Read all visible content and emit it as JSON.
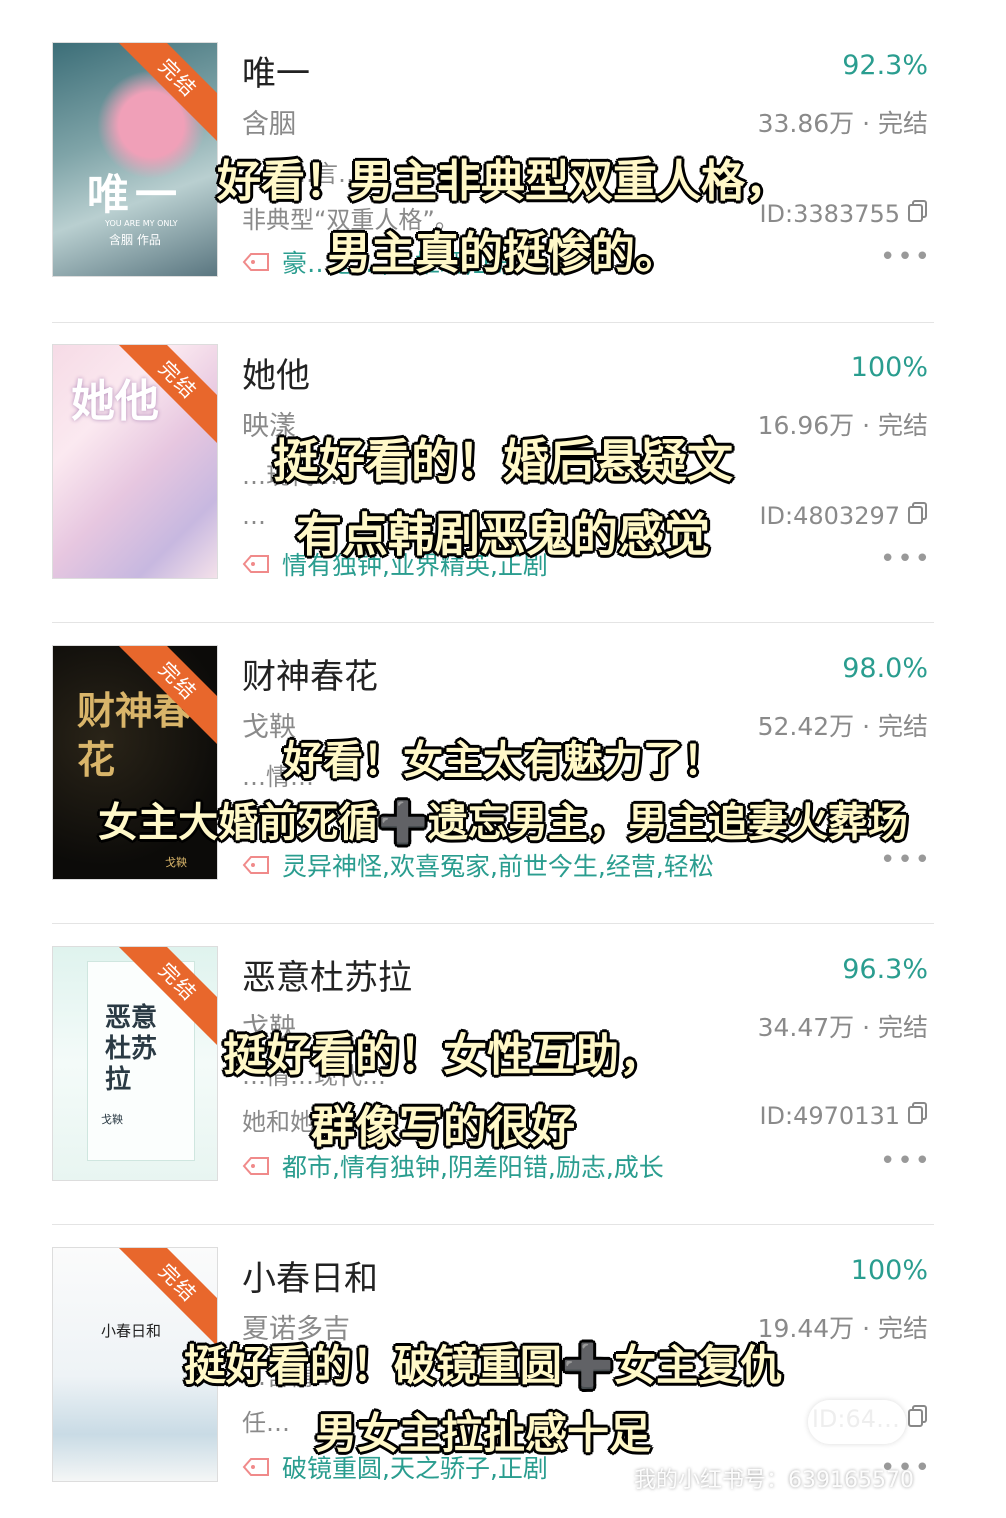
{
  "books": [
    {
      "title": "唯一",
      "author": "含胭",
      "line3": "…剧…言…",
      "line4": "非典型“双重人格”。",
      "tags": "豪…恋…,…推理,正剧",
      "percent": "92.3%",
      "meta": "33.86万 · 完结",
      "id": "ID:3383755",
      "ribbon": "完结",
      "cover_title": "唯一",
      "cover_sub": "YOU ARE MY ONLY",
      "cover_author": "含胭 作品",
      "overlay": [
        "好看！男主非典型双重人格，",
        "男主真的挺惨的。"
      ]
    },
    {
      "title": "她他",
      "author": "映漾",
      "line3": "…现代…",
      "line4": "…",
      "tags": "情有独钟,业界精英,正剧",
      "percent": "100%",
      "meta": "16.96万 · 完结",
      "id": "ID:4803297",
      "ribbon": "完结",
      "cover_title": "她他",
      "overlay": [
        "挺好看的！婚后悬疑文",
        "有点韩剧恶鬼的感觉"
      ]
    },
    {
      "title": "财神春花",
      "author": "戈鞅",
      "line3": "…情…",
      "line4": "…助…",
      "tags": "灵异神怪,欢喜冤家,前世今生,经营,轻松",
      "percent": "98.0%",
      "meta": "52.42万 · 完结",
      "id": "",
      "ribbon": "完结",
      "cover_title": "财神春花",
      "cover_author": "戈鞅",
      "overlay": [
        "好看！女主太有魅力了！",
        "女主大婚前死循➕遗忘男主，男主追妻火葬场"
      ]
    },
    {
      "title": "恶意杜苏拉",
      "author": "戈鞅",
      "line3": "…情…现代…",
      "line4": "她和她…",
      "tags": "都市,情有独钟,阴差阳错,励志,成长",
      "percent": "96.3%",
      "meta": "34.47万 · 完结",
      "id": "ID:4970131",
      "ribbon": "完结",
      "cover_title": "恶意杜苏拉",
      "cover_author": "戈鞅",
      "overlay": [
        "挺好看的！女性互助，",
        "群像写的很好"
      ]
    },
    {
      "title": "小春日和",
      "author": "夏诺多吉",
      "line3": "…言情…",
      "line4": "任…",
      "tags": "破镜重圆,天之骄子,正剧",
      "percent": "100%",
      "meta": "19.44万 · 完结",
      "id": "ID:64…",
      "ribbon": "完结",
      "cover_title": "小春日和",
      "overlay": [
        "挺好看的！破镜重圆➕女主复仇",
        "男女主拉扯感十足"
      ]
    }
  ],
  "more_label": "•••",
  "watermark": "我的小红书号：639165570",
  "colors": {
    "accent": "#2a9d8f",
    "ribbon": "#e8672c",
    "overlay_text": "#fff8c8"
  }
}
